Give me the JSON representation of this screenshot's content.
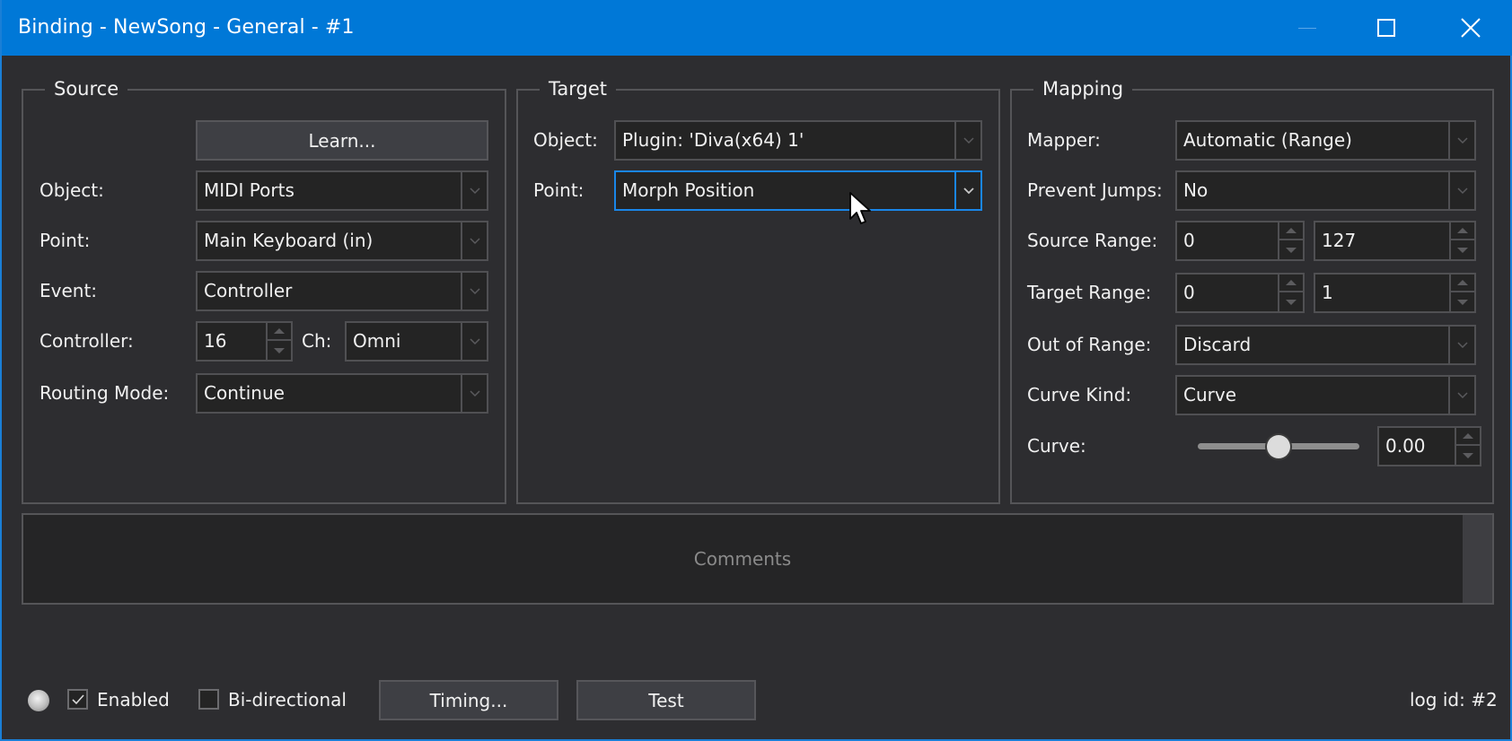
{
  "window": {
    "title": "Binding - NewSong - General - #1",
    "accent_color": "#0078d7",
    "focus_color": "#1a86e8",
    "controls": [
      "minimize-icon",
      "maximize-icon",
      "close-icon"
    ]
  },
  "source": {
    "title": "Source",
    "learn_label": "Learn...",
    "object_label": "Object:",
    "object_value": "MIDI Ports",
    "point_label": "Point:",
    "point_value": "Main Keyboard (in)",
    "event_label": "Event:",
    "event_value": "Controller",
    "controller_label": "Controller:",
    "controller_value": "16",
    "channel_label": "Ch:",
    "channel_value": "Omni",
    "routing_label": "Routing Mode:",
    "routing_value": "Continue"
  },
  "target": {
    "title": "Target",
    "object_label": "Object:",
    "object_value": "Plugin: 'Diva(x64) 1'",
    "point_label": "Point:",
    "point_value": "Morph Position"
  },
  "mapping": {
    "title": "Mapping",
    "mapper_label": "Mapper:",
    "mapper_value": "Automatic (Range)",
    "prevent_jumps_label": "Prevent Jumps:",
    "prevent_jumps_value": "No",
    "source_range_label": "Source Range:",
    "source_range_min": "0",
    "source_range_max": "127",
    "target_range_label": "Target Range:",
    "target_range_min": "0",
    "target_range_max": "1",
    "out_of_range_label": "Out of Range:",
    "out_of_range_value": "Discard",
    "curve_kind_label": "Curve Kind:",
    "curve_kind_value": "Curve",
    "curve_label": "Curve:",
    "curve_value": "0.00",
    "curve_slider_fraction": 0.5
  },
  "comments": {
    "placeholder": "Comments"
  },
  "footer": {
    "status_led": "inactive",
    "enabled_label": "Enabled",
    "enabled_checked": true,
    "bidirectional_label": "Bi-directional",
    "bidirectional_checked": false,
    "timing_label": "Timing...",
    "test_label": "Test",
    "log_id": "log id: #2"
  }
}
